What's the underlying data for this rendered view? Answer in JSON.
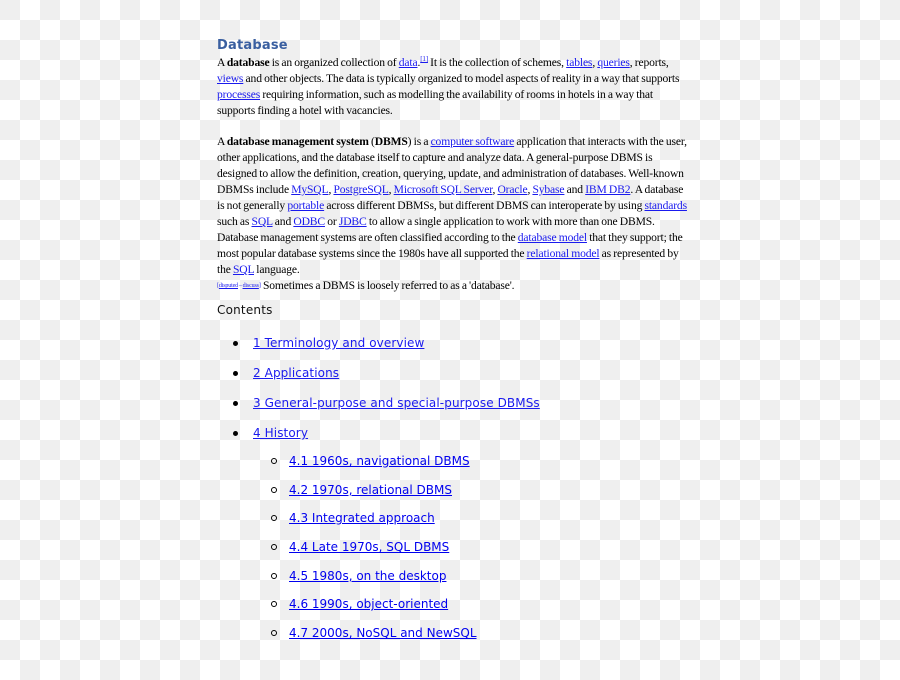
{
  "article": {
    "title": "Database",
    "p1": {
      "t1": "A ",
      "b1": "database",
      "t2": " is an organized collection of ",
      "l_data": "data",
      "ref1": "[1]",
      "t3": " It is the collection of schemes, ",
      "l_tables": "tables",
      "t4": ", ",
      "l_queries": "queries",
      "t5": ", reports, ",
      "l_views": "views",
      "t6": " and other objects. The data is typically organized to model aspects of reality in a way that supports ",
      "l_processes": "processes",
      "t7": " requiring information, such as modelling the availability of rooms in hotels in a way that supports finding a hotel with vacancies."
    },
    "p2": {
      "t1": "A ",
      "b1": "database management system",
      "t2": " (",
      "b2": "DBMS",
      "t3": ") is a ",
      "l_software": "computer software",
      "t4": " application that interacts with the user, other applications, and the database itself to capture and analyze data. A general-purpose DBMS is designed to allow the definition, creation, querying, update, and administration of databases. Well-known DBMSs include ",
      "l_mysql": "MySQL",
      "c1": ", ",
      "l_postgres": "PostgreSQL",
      "c2": ", ",
      "l_mssql": "Microsoft SQL Server",
      "c3": ", ",
      "l_oracle": "Oracle",
      "c4": ", ",
      "l_sybase": "Sybase",
      "t5": " and ",
      "l_db2": "IBM DB2",
      "t6": ". A database is not generally ",
      "l_portable": "portable",
      "t7": " across different DBMSs, but different DBMS can interoperate by using ",
      "l_standards": "standards",
      "t8": " such as ",
      "l_sql": "SQL",
      "t9": " and ",
      "l_odbc": "ODBC",
      "t10": " or ",
      "l_jdbc": "JDBC",
      "t11": " to allow a single application to work with more than one DBMS. Database management systems are often classified according to the ",
      "l_dbmodel": "database model",
      "t12": " that they support; the most popular database systems since the 1980s have all supported the ",
      "l_relmodel": "relational model",
      "t13": " as represented by the ",
      "l_sql2": "SQL",
      "t14": " language.",
      "disp_open": "[",
      "l_disputed": "disputed",
      "disp_sep": " – ",
      "l_discuss": "discuss",
      "disp_close": "]",
      "t15": " Sometimes a DBMS is loosely referred to as a 'database'."
    }
  },
  "contents": {
    "heading": "Contents",
    "items": [
      {
        "label": "1 Terminology and overview"
      },
      {
        "label": "2 Applications"
      },
      {
        "label": "3 General-purpose and special-purpose DBMSs"
      },
      {
        "label": "4 History"
      }
    ],
    "history_subitems": [
      {
        "label": "4.1 1960s, navigational DBMS"
      },
      {
        "label": "4.2 1970s, relational DBMS"
      },
      {
        "label": "4.3 Integrated approach"
      },
      {
        "label": "4.4 Late 1970s, SQL DBMS"
      },
      {
        "label": "4.5 1980s, on the desktop"
      },
      {
        "label": "4.6 1990s, object-oriented"
      },
      {
        "label": "4.7 2000s, NoSQL and NewSQL"
      }
    ]
  },
  "colors": {
    "title": "#3a5fa0",
    "link": "#1a1aee",
    "checker_light": "#ffffff",
    "checker_dark": "#efefef"
  }
}
